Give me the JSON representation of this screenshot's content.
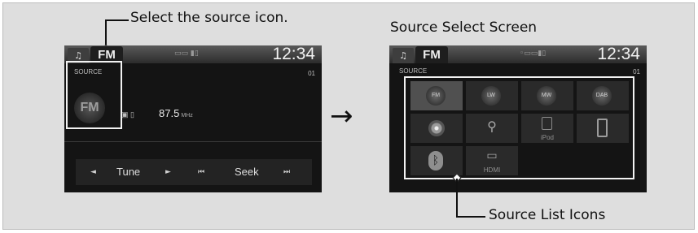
{
  "callouts": {
    "select_icon": "Select the source icon.",
    "source_select_screen": "Source Select Screen",
    "source_list_icons": "Source List Icons"
  },
  "arrow": "→",
  "left_screen": {
    "tab_icon": "♫",
    "source_tab": "FM",
    "status_icons": "▭▭  ▮▯",
    "clock": "12:34",
    "preset": "01",
    "source_label": "SOURCE",
    "big_source": "FM",
    "freq_icons": "▣ ▯",
    "frequency": "87.5",
    "frequency_unit": "MHz",
    "controls": {
      "prev_icon": "◄",
      "tune": "Tune",
      "next_icon": "►",
      "seek_back_icon": "⏮",
      "seek": "Seek",
      "seek_fwd_icon": "⏭"
    }
  },
  "right_screen": {
    "tab_icon": "♫",
    "source_tab": "FM",
    "status_icons": "◦▭▭▮▯",
    "clock": "12:34",
    "preset": "01",
    "source_label": "SOURCE",
    "sources": [
      {
        "label": "FM",
        "icon": "radio-fm-icon",
        "selected": true
      },
      {
        "label": "LW",
        "icon": "radio-lw-icon"
      },
      {
        "label": "MW",
        "icon": "radio-mw-icon"
      },
      {
        "label": "DAB",
        "icon": "radio-dab-icon"
      },
      {
        "label": "",
        "icon": "disc-icon"
      },
      {
        "label": "",
        "icon": "usb-icon",
        "glyph": "⚲"
      },
      {
        "label": "iPod",
        "icon": "ipod-icon"
      },
      {
        "label": "",
        "icon": "smartphone-icon"
      },
      {
        "label": "",
        "icon": "bluetooth-icon",
        "glyph": "ᛒ"
      },
      {
        "label": "HDMI",
        "icon": "hdmi-icon",
        "glyph": "▭"
      }
    ]
  }
}
